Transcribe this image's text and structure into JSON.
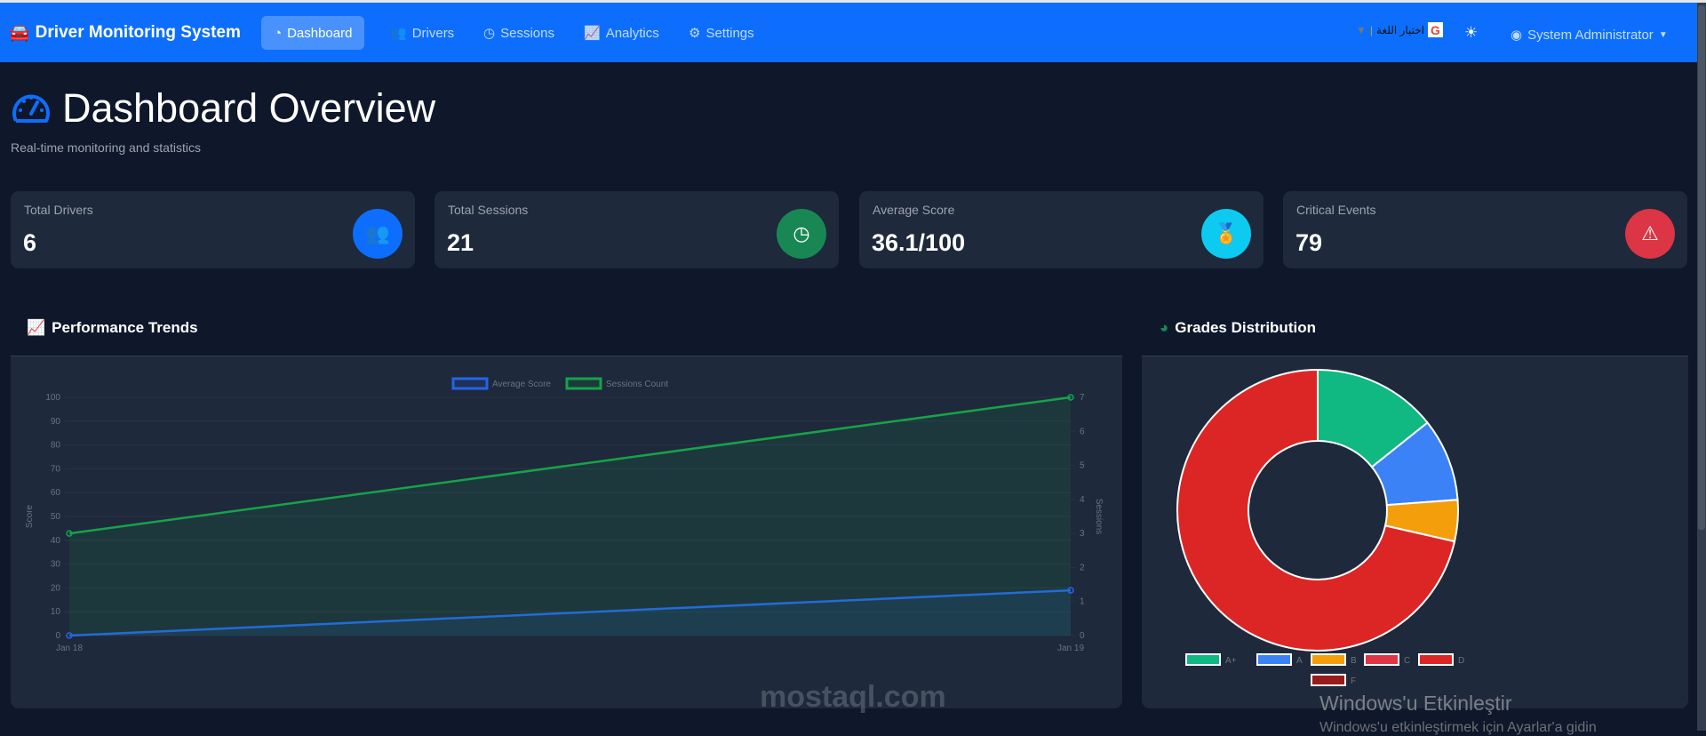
{
  "navbar": {
    "brand": "Driver Monitoring System",
    "items": [
      {
        "label": "Dashboard",
        "active": true
      },
      {
        "label": "Drivers"
      },
      {
        "label": "Sessions"
      },
      {
        "label": "Analytics"
      },
      {
        "label": "Settings"
      }
    ],
    "language": "اختيار اللغة",
    "user": "System Administrator"
  },
  "page": {
    "title": "Dashboard Overview",
    "subtitle": "Real-time monitoring and statistics"
  },
  "stats": [
    {
      "label": "Total Drivers",
      "value": "6",
      "icon": "users-icon",
      "color": "#0d6efd"
    },
    {
      "label": "Total Sessions",
      "value": "21",
      "icon": "clock-icon",
      "color": "#198754"
    },
    {
      "label": "Average Score",
      "value": "36.1/100",
      "icon": "award-icon",
      "color": "#0dcaf0"
    },
    {
      "label": "Critical Events",
      "value": "79",
      "icon": "warning-icon",
      "color": "#dc3545"
    }
  ],
  "sections": {
    "trends": "Performance Trends",
    "grades": "Grades Distribution"
  },
  "chart_data": [
    {
      "type": "line",
      "title": "Performance Trends",
      "x": [
        "Jan 18",
        "Jan 19"
      ],
      "series": [
        {
          "name": "Average Score",
          "values": [
            0,
            19
          ],
          "color": "#2563eb",
          "axis": "left"
        },
        {
          "name": "Sessions Count",
          "values": [
            3,
            7
          ],
          "color": "#16a34a",
          "axis": "right"
        }
      ],
      "ylabel": "Score",
      "ylim": [
        0,
        100
      ],
      "yticks": [
        "0",
        "10",
        "20",
        "30",
        "40",
        "50",
        "60",
        "70",
        "80",
        "90",
        "100"
      ],
      "y2label": "Sessions",
      "y2lim": [
        0,
        7
      ],
      "y2ticks": [
        "0",
        "1",
        "2",
        "3",
        "4",
        "5",
        "6",
        "7"
      ],
      "legend": "top",
      "grid": true
    },
    {
      "type": "pie",
      "title": "Grades Distribution",
      "donut": true,
      "categories": [
        "A+",
        "A",
        "B",
        "C",
        "D",
        "F"
      ],
      "values": [
        3,
        2,
        1,
        0,
        15,
        0
      ],
      "colors": [
        "#10b981",
        "#3b82f6",
        "#f59e0b",
        "#e03545",
        "#dc2626",
        "#991b1b"
      ],
      "legend": "bottom"
    }
  ],
  "watermark": {
    "title": "Windows'u Etkinleştir",
    "subtitle": "Windows'u etkinleştirmek için Ayarlar'a gidin",
    "site": "mostaql.com"
  }
}
